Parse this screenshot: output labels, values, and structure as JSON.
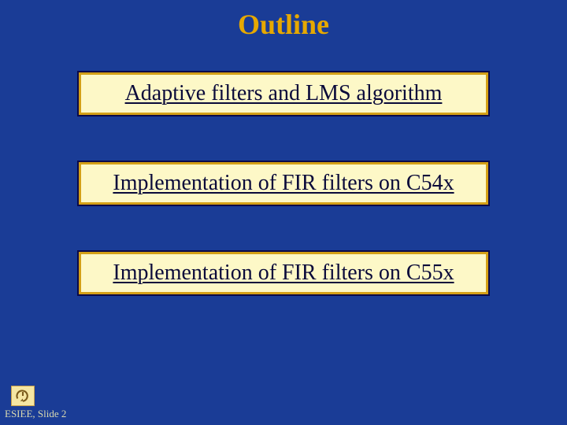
{
  "title": "Outline",
  "items": [
    {
      "label": "Adaptive filters and LMS algorithm"
    },
    {
      "label": "Implementation of FIR filters on C54x"
    },
    {
      "label": "Implementation of FIR filters on C55x"
    }
  ],
  "footer": {
    "label": "ESIEE, Slide 2"
  },
  "colors": {
    "background": "#1a3c96",
    "title": "#e6a800",
    "item_bg": "#fdf8c7",
    "item_border": "#d4a017",
    "item_text": "#0a0a3a"
  }
}
